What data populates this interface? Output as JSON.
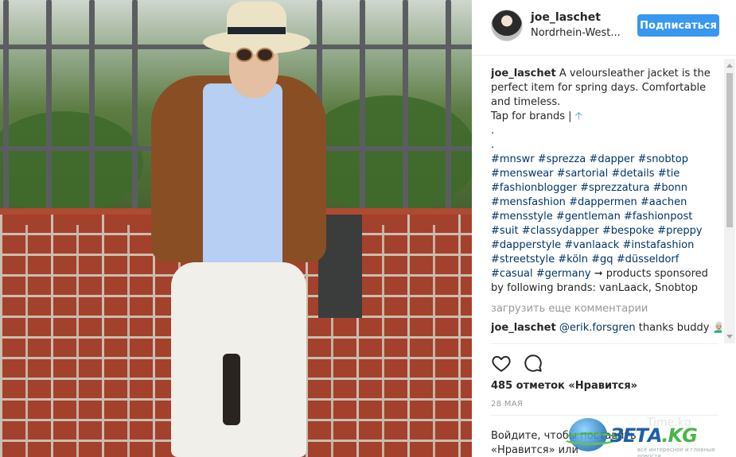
{
  "post": {
    "header": {
      "username": "joe_laschet",
      "location": "Nordrhein-West...",
      "follow_label": "Подписаться"
    },
    "caption": {
      "username": "joe_laschet",
      "text_line1": "A veloursleather jacket is the perfect item for spring days. Comfortable and timeless.",
      "text_line2": "Tap for brands |",
      "dot1": ".",
      "dot2": ".",
      "hashtags": [
        "#mnswr",
        "#sprezza",
        "#dapper",
        "#snobtop",
        "#menswear",
        "#sartorial",
        "#details",
        "#tie",
        "#fashionblogger",
        "#sprezzatura",
        "#bonn",
        "#mensfashion",
        "#dappermen",
        "#aachen",
        "#mensstyle",
        "#gentleman",
        "#fashionpost",
        "#suit",
        "#classydapper",
        "#bespoke",
        "#preppy",
        "#dapperstyle",
        "#vanlaack",
        "#instafashion",
        "#streetstyle",
        "#köln",
        "#gq",
        "#düsseldorf",
        "#casual",
        "#germany"
      ],
      "sponsored_text": "➞ products sponsored by following brands: vanLaack, Snobtop"
    },
    "load_more_label": "загрузить еще комментарии",
    "comment": {
      "username": "joe_laschet",
      "mention": "@erik.forsgren",
      "text": "thanks buddy 👨🏼‍🦳"
    },
    "likes_text": "485 отметок «Нравится»",
    "date_text": "28 МАЯ",
    "login_prompt": {
      "link_text": "Войдите",
      "text": ", чтобы поставить «Нравится» или прокомментировать."
    }
  },
  "icons": {
    "like": "heart-outline-icon",
    "comment": "speech-bubble-icon",
    "arrow_up": "up-arrow-emoji-icon"
  },
  "colors": {
    "follow_button": "#3897f0",
    "hashtag": "#003569",
    "muted": "#999999"
  },
  "watermark": {
    "brand": "ЗЕТА",
    "brand_suffix": ".KG",
    "tagline": "всё интересное и главные новости",
    "faint": "Time.kg"
  }
}
